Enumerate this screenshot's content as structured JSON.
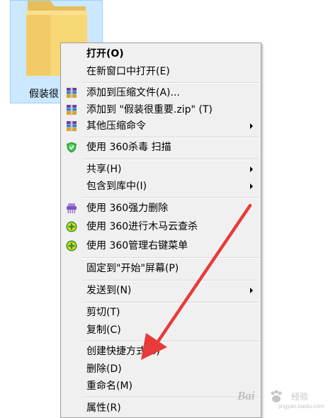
{
  "desktop": {
    "folder_label": "假装很"
  },
  "menu": {
    "items": [
      {
        "label": "打开(O)"
      },
      {
        "label": "在新窗口中打开(E)"
      },
      {
        "label": "添加到压缩文件(A)..."
      },
      {
        "label": "添加到 \"假装很重要.zip\" (T)"
      },
      {
        "label": "其他压缩命令"
      },
      {
        "label": "使用 360杀毒 扫描"
      },
      {
        "label": "共享(H)"
      },
      {
        "label": "包含到库中(I)"
      },
      {
        "label": "使用 360强力删除"
      },
      {
        "label": "使用 360进行木马云查杀"
      },
      {
        "label": "使用 360管理右键菜单"
      },
      {
        "label": "固定到\"开始\"屏幕(P)"
      },
      {
        "label": "发送到(N)"
      },
      {
        "label": "剪切(T)"
      },
      {
        "label": "复制(C)"
      },
      {
        "label": "创建快捷方式(S)"
      },
      {
        "label": "删除(D)"
      },
      {
        "label": "重命名(M)"
      },
      {
        "label": "属性(R)"
      }
    ]
  },
  "icons": {
    "folder": "folder-icon",
    "winrar": "winrar-icon",
    "shield": "360-shield-icon",
    "shredder": "360-shredder-icon",
    "plus": "360-plus-icon",
    "arrow": "submenu-arrow-icon"
  },
  "colors": {
    "menu_bg": "#f0f0f0",
    "selection_bg": "#cce8ff",
    "annotation_arrow": "#e83a3a"
  },
  "watermark": {
    "brand": "Bai",
    "sub": "经验",
    "url": "jingyan.baidu.com"
  }
}
